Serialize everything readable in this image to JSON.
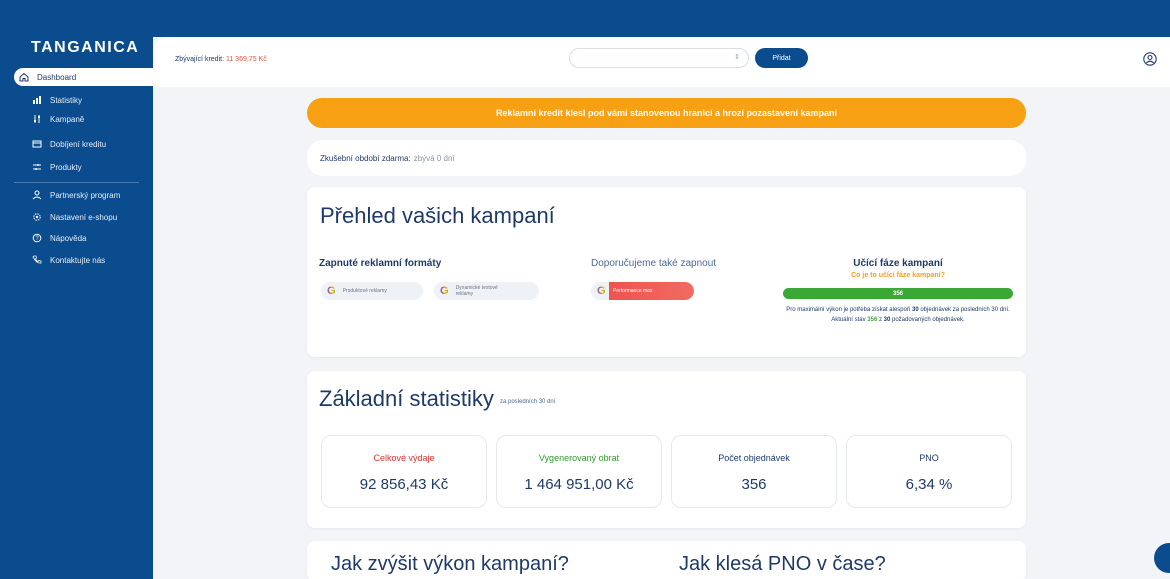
{
  "app": {
    "logo": "TANGANICA"
  },
  "sidebar": {
    "items": [
      {
        "label": "Dashboard",
        "icon": "home-icon",
        "active": true
      },
      {
        "label": "Statistiky",
        "icon": "bar-chart-icon"
      },
      {
        "label": "Kampaně",
        "icon": "sliders-icon"
      },
      {
        "label": "Dobíjení kreditu",
        "icon": "credit-card-icon"
      },
      {
        "label": "Produkty",
        "icon": "filter-icon"
      },
      {
        "label": "Partnerský program",
        "icon": "partner-icon"
      },
      {
        "label": "Nastavení e-shopu",
        "icon": "gear-icon"
      },
      {
        "label": "Nápověda",
        "icon": "help-icon"
      },
      {
        "label": "Kontaktujte nás",
        "icon": "phone-icon"
      }
    ]
  },
  "header": {
    "credit_label": "Zbývající kredit:",
    "credit_amount": "11 369,75 Kč",
    "add_button": "Přidat"
  },
  "alert": {
    "text": "Reklamní kredit klesl pod vámi stanovenou hranicí a hrozí pozastavení kampaní"
  },
  "trial": {
    "label": "Zkušební období zdarma:",
    "value": "zbývá 0 dní"
  },
  "overview": {
    "title": "Přehled vašich kampaní",
    "enabled_title": "Zapnuté reklamní formáty",
    "enabled": [
      "Produktové reklamy",
      "Dynamické textové reklamy"
    ],
    "recommend_title": "Doporučujeme také zapnout",
    "recommend": [
      "Performance max"
    ],
    "learning_title": "Učící fáze kampaní",
    "learning_link": "Co je to učící fáze kampaní?",
    "learning_value": "356",
    "learning_text_1": "Pro maximální výkon je potřeba získat alespoň",
    "learning_need": "30",
    "learning_text_2": "objednávek za posledních 30 dní. Aktuální stav",
    "learning_current": "356",
    "learning_text_3": "z",
    "learning_of": "30",
    "learning_text_4": "požadovaných objednávek."
  },
  "stats": {
    "title": "Základní statistiky",
    "period": "za posledních 30 dní",
    "boxes": [
      {
        "label": "Celkové výdaje",
        "value": "92 856,43 Kč",
        "color": "#e0302f"
      },
      {
        "label": "Vygenerovaný obrat",
        "value": "1 464 951,00 Kč",
        "color": "#2f9a2c"
      },
      {
        "label": "Počet objednávek",
        "value": "356",
        "color": "#1f3a68"
      },
      {
        "label": "PNO",
        "value": "6,34 %",
        "color": "#1f3a68"
      }
    ]
  },
  "bottom": {
    "left_title": "Jak zvýšit výkon kampaní?",
    "right_title": "Jak klesá PNO v čase?"
  },
  "colors": {
    "primary": "#0a4c8e",
    "warning": "#f7a013",
    "success": "#3aa835",
    "danger": "#e0302f"
  }
}
